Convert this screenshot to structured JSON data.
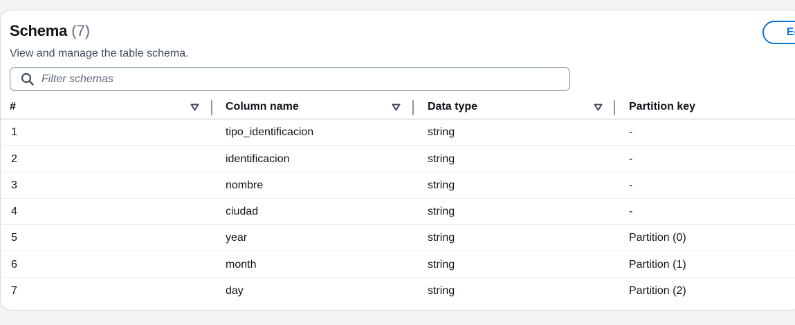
{
  "header": {
    "title": "Schema",
    "count": "(7)",
    "description": "View and manage the table schema.",
    "edit_label": "Edit"
  },
  "filter": {
    "placeholder": "Filter schemas",
    "icon": "search-icon"
  },
  "table": {
    "columns": [
      {
        "label": "#",
        "sortable": true
      },
      {
        "label": "Column name",
        "sortable": true
      },
      {
        "label": "Data type",
        "sortable": true
      },
      {
        "label": "Partition key",
        "sortable": false
      }
    ],
    "rows": [
      {
        "num": "1",
        "name": "tipo_identificacion",
        "type": "string",
        "partition": "-"
      },
      {
        "num": "2",
        "name": "identificacion",
        "type": "string",
        "partition": "-"
      },
      {
        "num": "3",
        "name": "nombre",
        "type": "string",
        "partition": "-"
      },
      {
        "num": "4",
        "name": "ciudad",
        "type": "string",
        "partition": "-"
      },
      {
        "num": "5",
        "name": "year",
        "type": "string",
        "partition": "Partition (0)"
      },
      {
        "num": "6",
        "name": "month",
        "type": "string",
        "partition": "Partition (1)"
      },
      {
        "num": "7",
        "name": "day",
        "type": "string",
        "partition": "Partition (2)"
      }
    ]
  },
  "colors": {
    "accent": "#0972d3",
    "text": "#0f141a",
    "muted": "#5f6b7a"
  }
}
